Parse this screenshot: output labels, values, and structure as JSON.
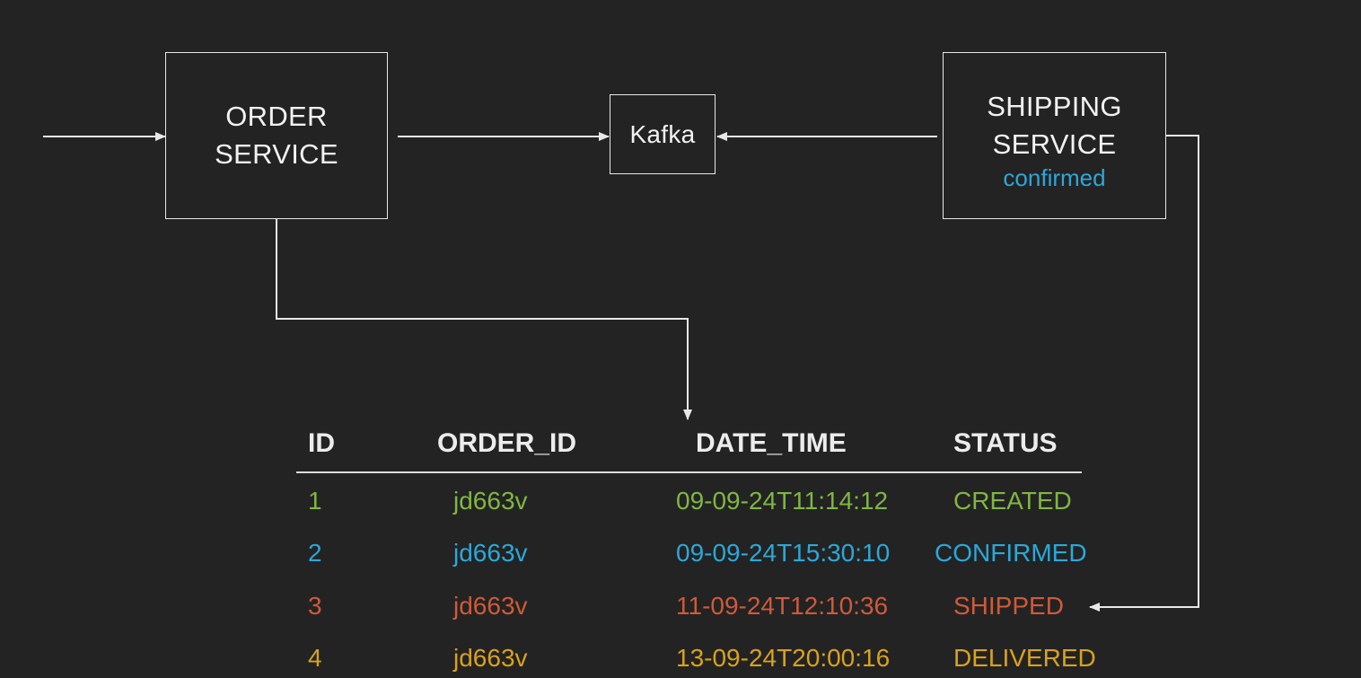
{
  "boxes": {
    "order_service": {
      "line1": "ORDER",
      "line2": "SERVICE"
    },
    "kafka": {
      "label": "Kafka"
    },
    "shipping_service": {
      "line1": "SHIPPING",
      "line2": "SERVICE",
      "status": "confirmed"
    }
  },
  "table": {
    "headers": [
      "ID",
      "ORDER_ID",
      "DATE_TIME",
      "STATUS"
    ],
    "rows": [
      {
        "id": "1",
        "order_id": "jd663v",
        "date_time": "09-09-24T11:14:12",
        "status": "CREATED",
        "color": "#7fb742"
      },
      {
        "id": "2",
        "order_id": "jd663v",
        "date_time": "09-09-24T15:30:10",
        "status": "CONFIRMED",
        "color": "#2ba8d8"
      },
      {
        "id": "3",
        "order_id": "jd663v",
        "date_time": "11-09-24T12:10:36",
        "status": "SHIPPED",
        "color": "#cf5a3a"
      },
      {
        "id": "4",
        "order_id": "jd663v",
        "date_time": "13-09-24T20:00:16",
        "status": "DELIVERED",
        "color": "#d9a21b"
      }
    ]
  },
  "colors": {
    "background": "#232323",
    "line": "#e8e8e8",
    "accent_confirmed": "#2ba8d8"
  }
}
